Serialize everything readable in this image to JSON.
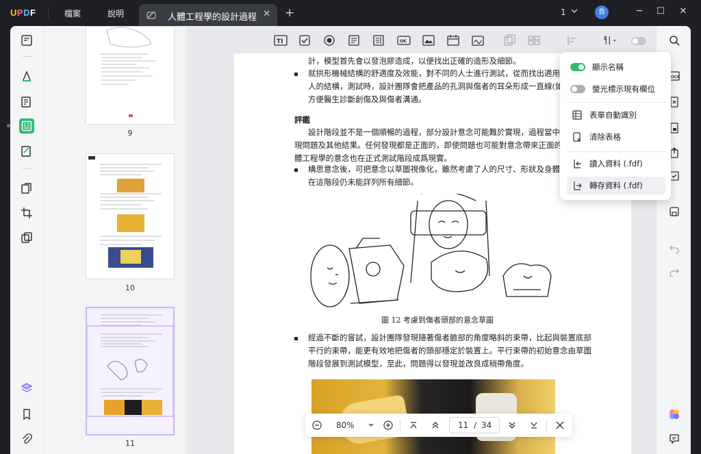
{
  "app": {
    "logo_letters": [
      "U",
      "P",
      "D",
      "F"
    ],
    "logo_colors": [
      "#ffc52b",
      "#ff6b9e",
      "#6ea8ff",
      "#ffffff"
    ]
  },
  "menu": {
    "file": "檔案",
    "help": "說明"
  },
  "tab": {
    "title": "人體工程學的設計過程",
    "close": "✕"
  },
  "titlebar": {
    "page_indicator": "1",
    "avatar_letter": "合"
  },
  "thumbnails": [
    {
      "label": "9"
    },
    {
      "label": "10"
    },
    {
      "label": "11",
      "selected": true
    }
  ],
  "document": {
    "lines": [
      "計，模型首先會以發泡膠造成，以便找出正確的造形及細節。",
      "就拱形機械結構的舒適度及效能，對不同的人士進行測試，從而找出適用於大部",
      "人的結構，測試時，設計團隊會把產品的孔洞與傷者的耳朵形成一直線(如可能",
      "方便醫生診斷創傷及與傷者溝通。",
      "評鑑",
      "設計階段並不是一個順暢的過程，部分設計意念可能難於實現，過程當中也可能",
      "現問題及其他結果。任何發現都是正面的，即使問題也可能對意念帶來正面的影響",
      "體工程學的意念也在正式測試階段成爲現實。",
      "構思意念後，可把意念以草圖視像化，雖然考慮了人的尺寸、形狀及身體特徵",
      "在這階段仍未能詳列所有細節。",
      "經過不斷的嘗試，設計團隊發現隨著傷者臉部的角度略斜的束帶，比起與裝置底部",
      "平行的束帶，能更有效地把傷者的頭部穩定於裝置上。平行束帶的初始意念由草圖",
      "階段發展到測試模型，至此，問題得以發現並改良成稍帶角度。"
    ],
    "figure_caption": "圖 12  考慮到傷者頭部的意念草圖"
  },
  "dropdown": {
    "items": [
      {
        "label": "顯示名稱",
        "toggle": "on"
      },
      {
        "label": "螢光標示現有欄位",
        "toggle": "off"
      },
      {
        "label": "表單自動識別",
        "icon": "form-detect-icon"
      },
      {
        "label": "清除表格",
        "icon": "clear-form-icon"
      },
      {
        "label": "讀入資料 (.fdf)",
        "icon": "import-icon"
      },
      {
        "label": "轉存資料 (.fdf)",
        "icon": "export-icon"
      }
    ]
  },
  "navbar": {
    "zoom": "80%",
    "current_page": "11",
    "separator": "/",
    "total_pages": "34"
  },
  "colors": {
    "accent_green": "#2dbb72",
    "titlebar": "#1f2025",
    "tab": "#3a3c44"
  }
}
